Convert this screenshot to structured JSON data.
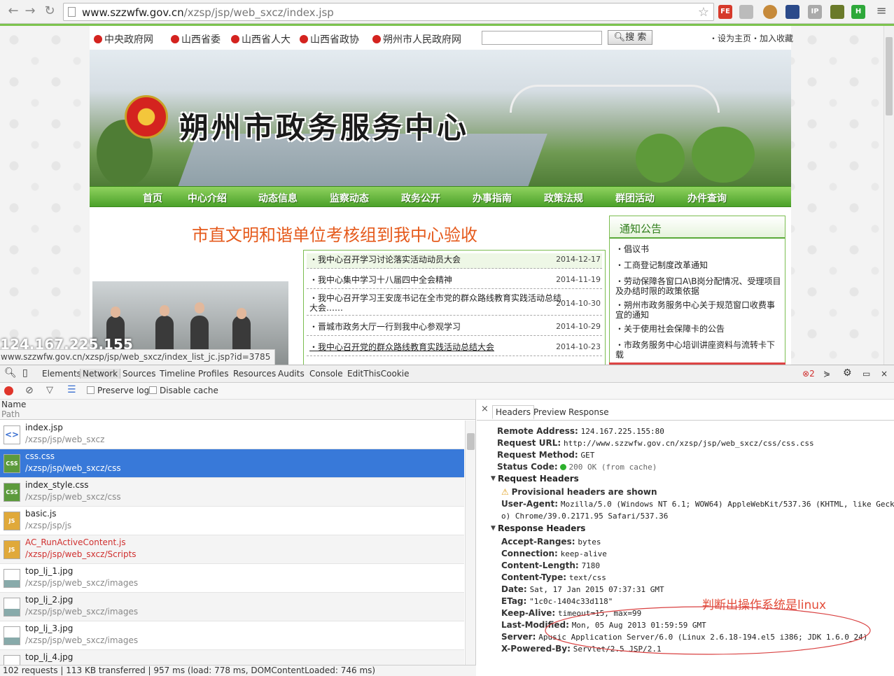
{
  "browser": {
    "url_host": "www.szzwfw.gov.cn",
    "url_path": "/xzsp/jsp/web_sxcz/index.jsp",
    "extensions": [
      "FE",
      "IP",
      "H"
    ]
  },
  "page": {
    "top_links": [
      "中央政府网",
      "山西省委",
      "山西省人大",
      "山西省政协",
      "朔州市人民政府网"
    ],
    "search_button": "搜 索",
    "right_links": "・设为主页・加入收藏",
    "banner_title": "朔州市政务服务中心",
    "nav": [
      "首页",
      "中心介绍",
      "动态信息",
      "监察动态",
      "政务公开",
      "办事指南",
      "政策法规",
      "群团活动",
      "办件查询"
    ],
    "headline": "市直文明和谐单位考核组到我中心验收",
    "news": [
      {
        "title": "・我中心召开学习讨论落实活动动员大会",
        "date": "2014-12-17"
      },
      {
        "title": "・我中心集中学习十八届四中全会精神",
        "date": "2014-11-19"
      },
      {
        "title": "・我中心召开学习王安庞书记在全市党的群众路线教育实践活动总结大会……",
        "date": "2014-10-30"
      },
      {
        "title": "・晋城市政务大厅一行到我中心参观学习",
        "date": "2014-10-29"
      },
      {
        "title": "・我中心召开党的群众路线教育实践活动总结大会",
        "date": "2014-10-23"
      }
    ],
    "notice_title": "通知公告",
    "notices": [
      "・倡议书",
      "・工商登记制度改革通知",
      "・劳动保障各窗口A\\B岗分配情况、受理项目及办结时限的政策依据",
      "・朔州市政务服务中心关于规范窗口收费事宜的通知",
      "・关于使用社会保障卡的公告",
      "・市政务服务中心培训讲座资料与流转卡下载"
    ],
    "ip_overlay": "124.167.225.155",
    "status_url": "www.szzwfw.gov.cn/xzsp/jsp/web_sxcz/index_list_jc.jsp?id=3785"
  },
  "devtools": {
    "tabs": [
      "Elements",
      "Network",
      "Sources",
      "Timeline",
      "Profiles",
      "Resources",
      "Audits",
      "Console",
      "EditThisCookie"
    ],
    "error_count": "2",
    "preserve_log": "Preserve log",
    "disable_cache": "Disable cache",
    "col_name": "Name",
    "col_path": "Path",
    "requests": [
      {
        "name": "index.jsp",
        "path": "/xzsp/jsp/web_sxcz",
        "icon": "document-icon",
        "label": ""
      },
      {
        "name": "css.css",
        "path": "/xzsp/jsp/web_sxcz/css",
        "icon": "css-file-icon",
        "label": "CSS"
      },
      {
        "name": "index_style.css",
        "path": "/xzsp/jsp/web_sxcz/css",
        "icon": "css-file-icon",
        "label": "CSS"
      },
      {
        "name": "basic.js",
        "path": "/xzsp/jsp/js",
        "icon": "js-file-icon",
        "label": "JS"
      },
      {
        "name": "AC_RunActiveContent.js",
        "path": "/xzsp/jsp/web_sxcz/Scripts",
        "icon": "js-file-icon",
        "label": "JS"
      },
      {
        "name": "top_lj_1.jpg",
        "path": "/xzsp/jsp/web_sxcz/images",
        "icon": "image-file-icon",
        "label": ""
      },
      {
        "name": "top_lj_2.jpg",
        "path": "/xzsp/jsp/web_sxcz/images",
        "icon": "image-file-icon",
        "label": ""
      },
      {
        "name": "top_lj_3.jpg",
        "path": "/xzsp/jsp/web_sxcz/images",
        "icon": "image-file-icon",
        "label": ""
      },
      {
        "name": "top_lj_4.jpg",
        "path": "",
        "icon": "image-file-icon",
        "label": ""
      }
    ],
    "summary": "102 requests  |  113 KB transferred  |  957 ms (load: 778 ms, DOMContentLoaded: 746 ms)",
    "detail_tabs": [
      "Headers",
      "Preview",
      "Response"
    ],
    "general": [
      {
        "k": "Remote Address:",
        "v": "124.167.225.155:80"
      },
      {
        "k": "Request URL:",
        "v": "http://www.szzwfw.gov.cn/xzsp/jsp/web_sxcz/css/css.css"
      },
      {
        "k": "Request Method:",
        "v": "GET"
      },
      {
        "k": "Status Code:",
        "v": "200 OK (from cache)"
      }
    ],
    "request_headers_title": "Request Headers",
    "provisional": "Provisional headers are shown",
    "user_agent_key": "User-Agent:",
    "user_agent_1": "Mozilla/5.0 (Windows NT 6.1; WOW64) AppleWebKit/537.36 (KHTML, like Geck",
    "user_agent_2": "o) Chrome/39.0.2171.95 Safari/537.36",
    "response_headers_title": "Response Headers",
    "response_headers": [
      {
        "k": "Accept-Ranges:",
        "v": "bytes"
      },
      {
        "k": "Connection:",
        "v": "keep-alive"
      },
      {
        "k": "Content-Length:",
        "v": "7180"
      },
      {
        "k": "Content-Type:",
        "v": "text/css"
      },
      {
        "k": "Date:",
        "v": "Sat, 17 Jan 2015 07:37:31 GMT"
      },
      {
        "k": "ETag:",
        "v": "\"1c0c-1404c33d118\""
      },
      {
        "k": "Keep-Alive:",
        "v": "timeout=15, max=99"
      },
      {
        "k": "Last-Modified:",
        "v": "Mon, 05 Aug 2013 01:59:59 GMT"
      },
      {
        "k": "Server:",
        "v": "Apusic Application Server/6.0 (Linux 2.6.18-194.el5 i386; JDK 1.6.0_24)"
      },
      {
        "k": "X-Powered-By:",
        "v": "Servlet/2.5 JSP/2.1"
      }
    ],
    "annotation": "判断出操作系统是linux"
  }
}
